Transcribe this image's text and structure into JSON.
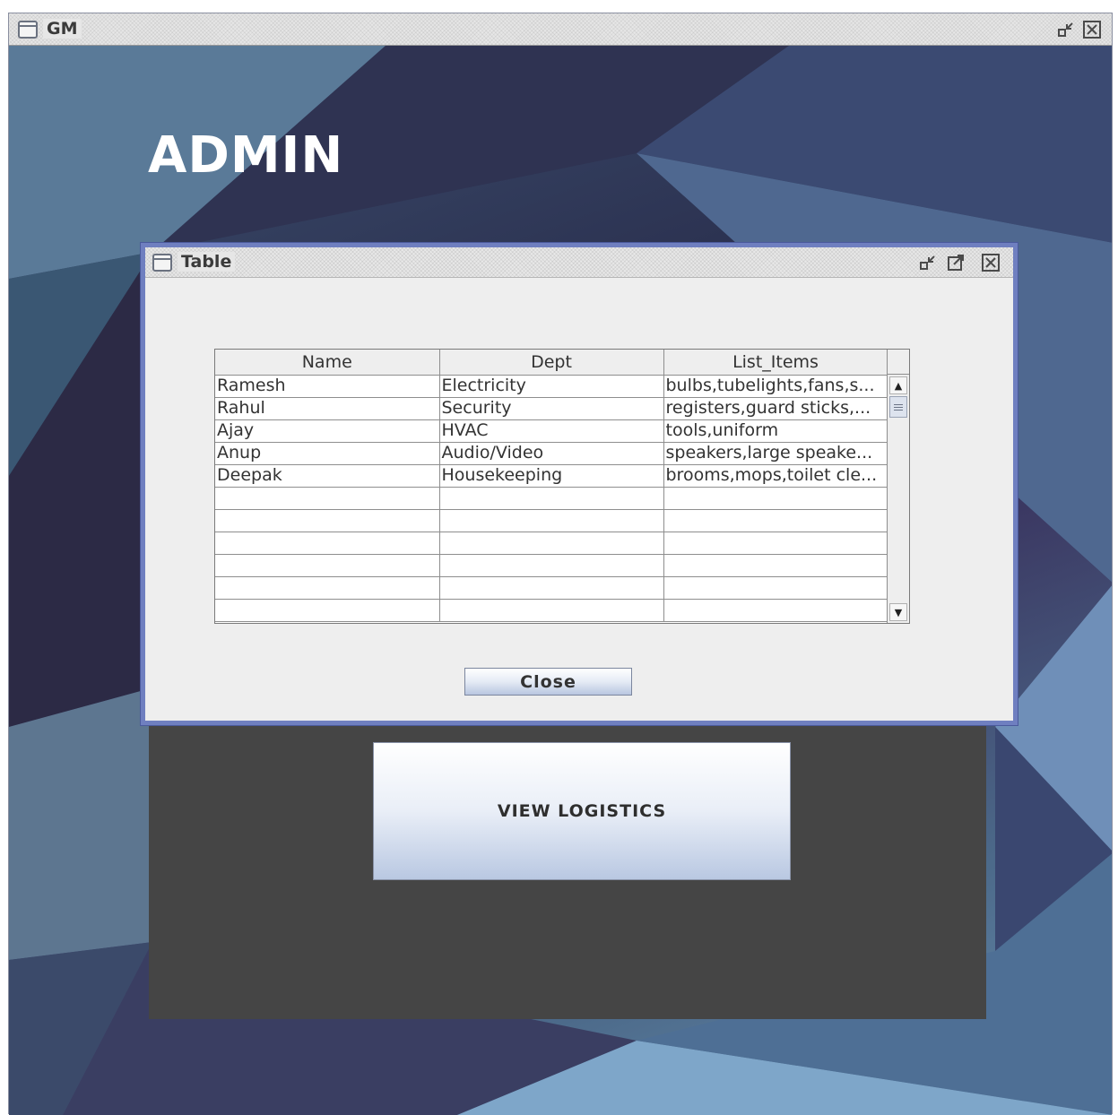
{
  "main_window": {
    "title": "GM",
    "icon": "window-icon"
  },
  "admin": {
    "heading": "ADMIN",
    "view_logistics_label": "VIEW LOGISTICS"
  },
  "dialog": {
    "title": "Table",
    "close_label": "Close",
    "table": {
      "columns": [
        "Name",
        "Dept",
        "List_Items"
      ],
      "rows": [
        [
          "Ramesh",
          "Electricity",
          "bulbs,tubelights,fans,s..."
        ],
        [
          "Rahul",
          "Security",
          "registers,guard sticks,..."
        ],
        [
          "Ajay",
          "HVAC",
          "tools,uniform"
        ],
        [
          "Anup",
          "Audio/Video",
          "speakers,large speake..."
        ],
        [
          "Deepak",
          "Housekeeping",
          "brooms,mops,toilet cle..."
        ],
        [
          "",
          "",
          ""
        ],
        [
          "",
          "",
          ""
        ],
        [
          "",
          "",
          ""
        ],
        [
          "",
          "",
          ""
        ],
        [
          "",
          "",
          ""
        ],
        [
          "",
          "",
          ""
        ]
      ]
    }
  },
  "colors": {
    "dialog_border": "#6f7fc0",
    "dark_panel": "#454545"
  }
}
